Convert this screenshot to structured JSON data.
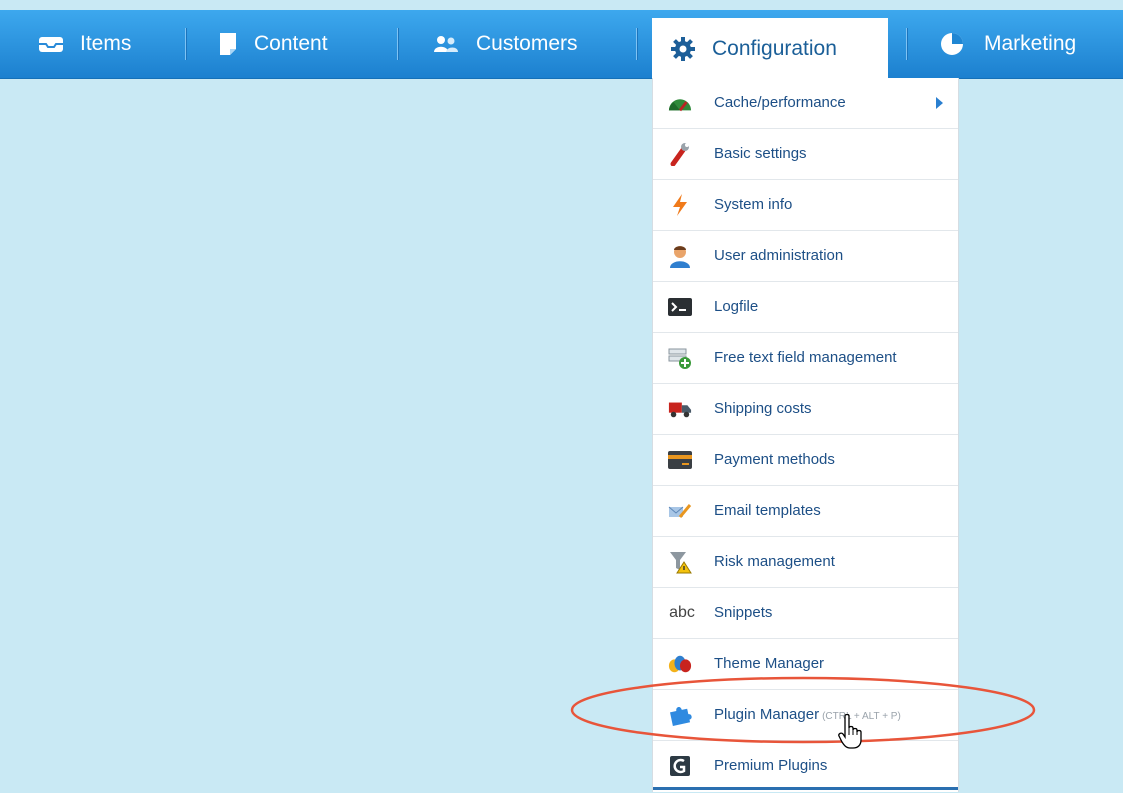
{
  "nav": {
    "items": [
      {
        "label": "Items",
        "icon": "inbox-icon"
      },
      {
        "label": "Content",
        "icon": "document-icon"
      },
      {
        "label": "Customers",
        "icon": "users-icon"
      },
      {
        "label": "Configuration",
        "icon": "gear-icon",
        "active": true
      },
      {
        "label": "Marketing",
        "icon": "pie-chart-icon"
      }
    ]
  },
  "menu": {
    "items": [
      {
        "label": "Cache/performance",
        "icon": "speedometer-icon",
        "has_submenu": true
      },
      {
        "label": "Basic settings",
        "icon": "wrench-icon"
      },
      {
        "label": "System info",
        "icon": "lightning-icon"
      },
      {
        "label": "User administration",
        "icon": "user-icon"
      },
      {
        "label": "Logfile",
        "icon": "terminal-icon"
      },
      {
        "label": "Free text field management",
        "icon": "field-add-icon"
      },
      {
        "label": "Shipping costs",
        "icon": "truck-icon"
      },
      {
        "label": "Payment methods",
        "icon": "credit-card-icon"
      },
      {
        "label": "Email templates",
        "icon": "email-edit-icon"
      },
      {
        "label": "Risk management",
        "icon": "filter-warning-icon"
      },
      {
        "label": "Snippets",
        "icon": "abc-icon",
        "icon_text": "abc"
      },
      {
        "label": "Theme Manager",
        "icon": "paint-drops-icon"
      },
      {
        "label": "Plugin Manager",
        "icon": "puzzle-icon",
        "shortcut": "(CTRL + ALT + P)"
      },
      {
        "label": "Premium Plugins",
        "icon": "shopware-logo-icon"
      }
    ]
  },
  "colors": {
    "background": "#c9e9f4",
    "nav_top": "#3da8ee",
    "nav_bottom": "#1c80cf",
    "menu_text": "#1d4f86",
    "highlight_ring": "#e8553a"
  }
}
